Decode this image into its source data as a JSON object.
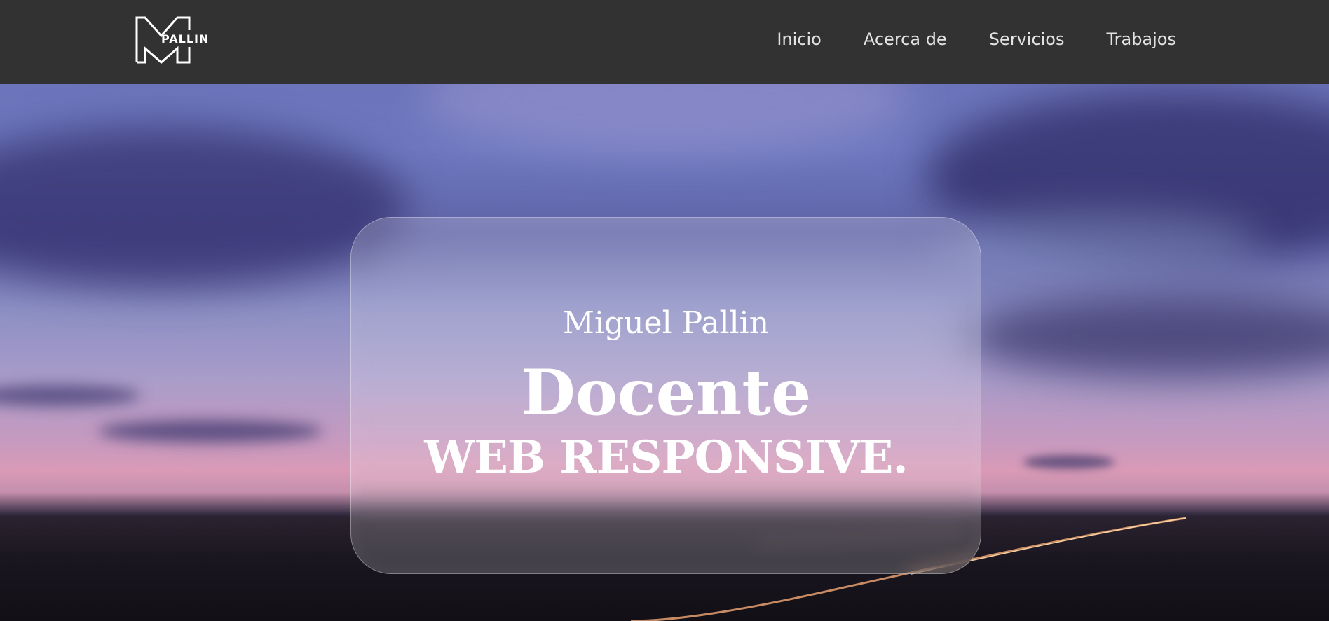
{
  "header": {
    "logo_text": "PALLIN",
    "nav": [
      {
        "label": "Inicio"
      },
      {
        "label": "Acerca de"
      },
      {
        "label": "Servicios"
      },
      {
        "label": "Trabajos"
      }
    ]
  },
  "hero": {
    "name": "Miguel Pallin",
    "role": "Docente",
    "subtitle": "WEB RESPONSIVE."
  },
  "colors": {
    "header_bg": "#333232",
    "nav_text": "#e3e3e3",
    "hero_text": "#ffffff"
  }
}
